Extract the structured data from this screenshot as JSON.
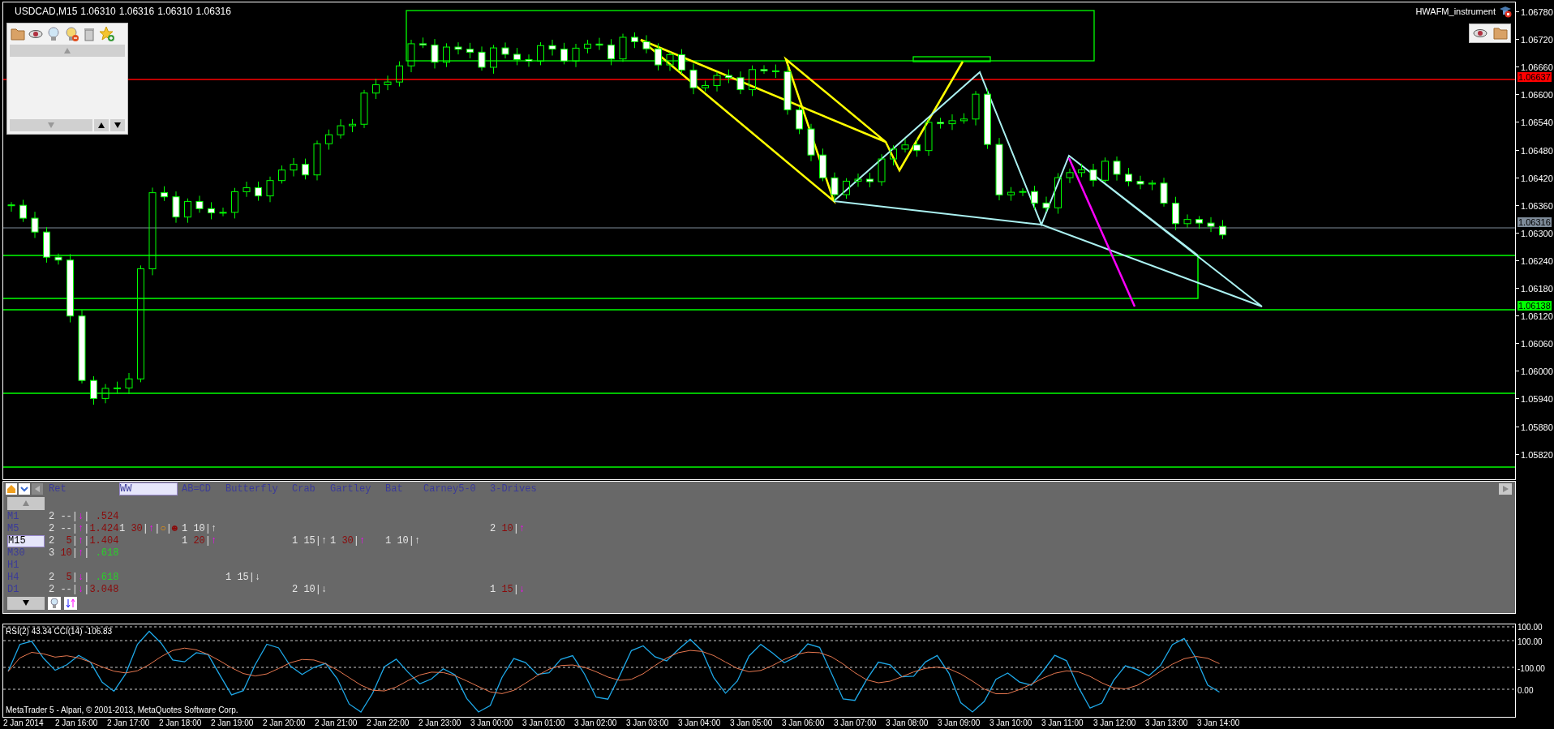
{
  "chart": {
    "symbol": "USDCAD,M15",
    "quotes": [
      "1.06310",
      "1.06316",
      "1.06310",
      "1.06316"
    ],
    "indicator_name": "HWAFM_instrument",
    "price_labels": [
      "1.06780",
      "1.06720",
      "1.06660",
      "1.06600",
      "1.06540",
      "1.06480",
      "1.06420",
      "1.06360",
      "1.06300",
      "1.06240",
      "1.06180",
      "1.06120",
      "1.06060",
      "1.06000",
      "1.05940",
      "1.05880",
      "1.05820"
    ],
    "price_badges": [
      {
        "text": "1.06637",
        "color": "#ff0000"
      },
      {
        "text": "1.06316",
        "color": "#7f8c9a"
      },
      {
        "text": "1.06138",
        "color": "#00ff00"
      }
    ]
  },
  "pattern_panel": {
    "tabs": [
      {
        "label": "Ret",
        "selected": false
      },
      {
        "label": "WW",
        "selected": true
      },
      {
        "label": "AB=CD",
        "selected": false
      },
      {
        "label": "Butterfly",
        "selected": false
      },
      {
        "label": "Crab",
        "selected": false
      },
      {
        "label": "Gartley",
        "selected": false
      },
      {
        "label": "Bat",
        "selected": false
      },
      {
        "label": "Carney5-0",
        "selected": false
      },
      {
        "label": "3-Drives",
        "selected": false
      }
    ],
    "rows": [
      {
        "timeframe": "M1",
        "selected": false,
        "cells": [
          [
            {
              "t": "2 --|",
              "kind": "plain"
            },
            {
              "t": "↓",
              "kind": "magenta"
            },
            {
              "t": "| ",
              "kind": "plain"
            },
            {
              "t": ".524",
              "kind": "red"
            }
          ]
        ]
      },
      {
        "timeframe": "M5",
        "selected": false,
        "cells": [
          [
            {
              "t": "2 --|",
              "kind": "plain"
            },
            {
              "t": "↑",
              "kind": "magenta"
            },
            {
              "t": "|",
              "kind": "plain"
            },
            {
              "t": "1.424",
              "kind": "red"
            }
          ],
          [
            {
              "t": "1 ",
              "kind": "plain"
            },
            {
              "t": "30",
              "kind": "red"
            },
            {
              "t": "|",
              "kind": "plain"
            },
            {
              "t": "↑",
              "kind": "magenta"
            },
            {
              "t": "|",
              "kind": "plain"
            },
            {
              "t": "○",
              "kind": "orange"
            },
            {
              "t": "|",
              "kind": "plain"
            },
            {
              "t": "☻",
              "kind": "red"
            }
          ],
          [
            {
              "t": "1 10|↑",
              "kind": "plain"
            }
          ],
          null,
          null,
          null,
          null,
          null,
          [
            {
              "t": "2 ",
              "kind": "plain"
            },
            {
              "t": "10",
              "kind": "red"
            },
            {
              "t": "|",
              "kind": "plain"
            },
            {
              "t": "↑",
              "kind": "magenta"
            }
          ]
        ]
      },
      {
        "timeframe": "M15",
        "selected": true,
        "cells": [
          [
            {
              "t": "2 ",
              "kind": "plain"
            },
            {
              "t": " 5",
              "kind": "red"
            },
            {
              "t": "|",
              "kind": "plain"
            },
            {
              "t": "↑",
              "kind": "magenta"
            },
            {
              "t": "|",
              "kind": "plain"
            },
            {
              "t": "1.404",
              "kind": "red"
            }
          ],
          null,
          [
            {
              "t": "1 ",
              "kind": "plain"
            },
            {
              "t": "20",
              "kind": "red"
            },
            {
              "t": "|",
              "kind": "plain"
            },
            {
              "t": "↑",
              "kind": "magenta"
            }
          ],
          null,
          [
            {
              "t": "1 15|↑",
              "kind": "plain"
            }
          ],
          [
            {
              "t": "1 ",
              "kind": "plain"
            },
            {
              "t": "30",
              "kind": "red"
            },
            {
              "t": "|",
              "kind": "plain"
            },
            {
              "t": "↑",
              "kind": "magenta"
            }
          ],
          [
            {
              "t": "1 10|↑",
              "kind": "plain"
            }
          ]
        ]
      },
      {
        "timeframe": "M30",
        "selected": false,
        "cells": [
          [
            {
              "t": "3 ",
              "kind": "plain"
            },
            {
              "t": "10",
              "kind": "red"
            },
            {
              "t": "|",
              "kind": "plain"
            },
            {
              "t": "↑",
              "kind": "magenta"
            },
            {
              "t": "| ",
              "kind": "plain"
            },
            {
              "t": ".618",
              "kind": "green"
            }
          ]
        ]
      },
      {
        "timeframe": "H1",
        "selected": false
      },
      {
        "timeframe": "H4",
        "selected": false,
        "cells": [
          [
            {
              "t": "2 ",
              "kind": "plain"
            },
            {
              "t": " 5",
              "kind": "red"
            },
            {
              "t": "|",
              "kind": "plain"
            },
            {
              "t": "↓",
              "kind": "magenta"
            },
            {
              "t": "| ",
              "kind": "plain"
            },
            {
              "t": ".618",
              "kind": "green"
            }
          ],
          null,
          null,
          [
            {
              "t": "1 15|↓",
              "kind": "plain"
            }
          ]
        ]
      },
      {
        "timeframe": "D1",
        "selected": false,
        "cells": [
          [
            {
              "t": "2 --|",
              "kind": "plain"
            },
            {
              "t": "↓",
              "kind": "magenta"
            },
            {
              "t": "|",
              "kind": "plain"
            },
            {
              "t": "3.048",
              "kind": "red"
            }
          ],
          null,
          null,
          null,
          [
            {
              "t": "2 10|↓",
              "kind": "plain"
            }
          ],
          null,
          null,
          null,
          [
            {
              "t": "1 ",
              "kind": "plain"
            },
            {
              "t": "15",
              "kind": "red"
            },
            {
              "t": "|",
              "kind": "plain"
            },
            {
              "t": "↓",
              "kind": "magenta"
            }
          ]
        ]
      }
    ]
  },
  "indicator": {
    "title": "RSI(2) 43.34 CCI(14) -106.83",
    "copyright": "MetaTrader 5 - Alpari, © 2001-2013, MetaQuotes Software Corp.",
    "levels": [
      "100.00",
      "100.00",
      "-100.00",
      "0.00"
    ]
  },
  "time_axis": [
    "2 Jan 2014",
    "2 Jan 16:00",
    "2 Jan 17:00",
    "2 Jan 18:00",
    "2 Jan 19:00",
    "2 Jan 20:00",
    "2 Jan 21:00",
    "2 Jan 22:00",
    "2 Jan 23:00",
    "3 Jan 00:00",
    "3 Jan 01:00",
    "3 Jan 02:00",
    "3 Jan 03:00",
    "3 Jan 04:00",
    "3 Jan 05:00",
    "3 Jan 06:00",
    "3 Jan 07:00",
    "3 Jan 08:00",
    "3 Jan 09:00",
    "3 Jan 10:00",
    "3 Jan 11:00",
    "3 Jan 12:00",
    "3 Jan 13:00",
    "3 Jan 14:00"
  ]
}
